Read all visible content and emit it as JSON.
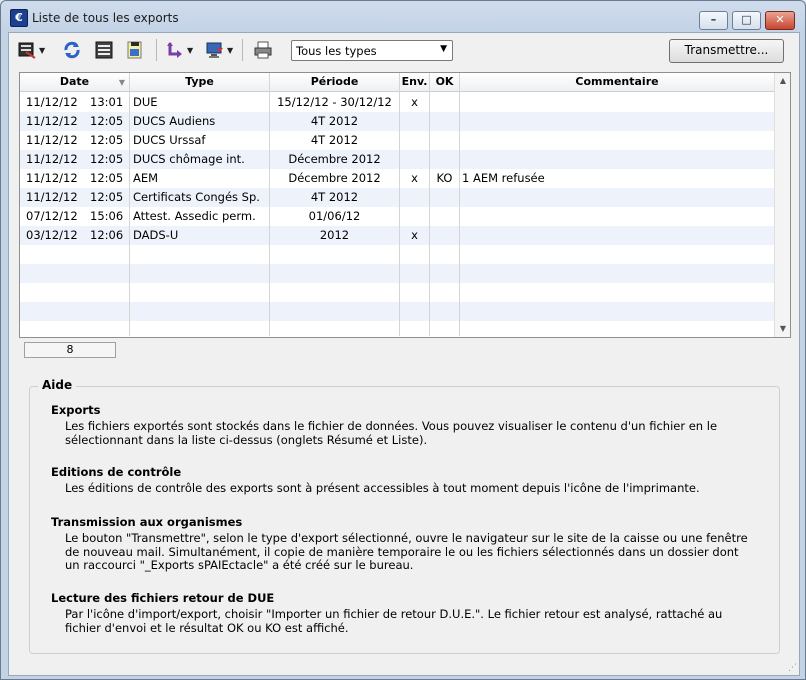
{
  "window": {
    "title": "Liste de tous les exports",
    "app_icon_letter": "€"
  },
  "toolbar": {
    "icons": [
      "export-list-icon",
      "refresh-icon",
      "records-icon",
      "edit-document-icon",
      "import-export-icon",
      "monitor-icon",
      "printer-icon"
    ],
    "type_select": "Tous les types",
    "transmit_label": "Transmettre..."
  },
  "grid": {
    "headers": [
      "Date",
      "Type",
      "Période",
      "Env.",
      "OK",
      "Commentaire"
    ],
    "rows": [
      {
        "date": "11/12/12",
        "time": "13:01",
        "type": "DUE",
        "period": "15/12/12 - 30/12/12",
        "env": "x",
        "ok": "",
        "comment": ""
      },
      {
        "date": "11/12/12",
        "time": "12:05",
        "type": "DUCS Audiens",
        "period": "4T 2012",
        "env": "",
        "ok": "",
        "comment": ""
      },
      {
        "date": "11/12/12",
        "time": "12:05",
        "type": "DUCS Urssaf",
        "period": "4T 2012",
        "env": "",
        "ok": "",
        "comment": ""
      },
      {
        "date": "11/12/12",
        "time": "12:05",
        "type": "DUCS chômage int.",
        "period": "Décembre 2012",
        "env": "",
        "ok": "",
        "comment": ""
      },
      {
        "date": "11/12/12",
        "time": "12:05",
        "type": "AEM",
        "period": "Décembre 2012",
        "env": "x",
        "ok": "KO",
        "comment": "1 AEM refusée"
      },
      {
        "date": "11/12/12",
        "time": "12:05",
        "type": "Certificats Congés Sp.",
        "period": "4T 2012",
        "env": "",
        "ok": "",
        "comment": ""
      },
      {
        "date": "07/12/12",
        "time": "15:06",
        "type": "Attest. Assedic perm.",
        "period": "01/06/12",
        "env": "",
        "ok": "",
        "comment": ""
      },
      {
        "date": "03/12/12",
        "time": "12:06",
        "type": "DADS-U",
        "period": "2012",
        "env": "x",
        "ok": "",
        "comment": ""
      }
    ],
    "count": "8"
  },
  "help": {
    "title": "Aide",
    "sections": [
      {
        "title": "Exports",
        "text": "Les fichiers exportés sont stockés dans le fichier de données. Vous pouvez visualiser le contenu d'un fichier en le sélectionnant dans la liste ci-dessus (onglets Résumé et Liste)."
      },
      {
        "title": "Editions de contrôle",
        "text": "Les éditions de contrôle des exports sont à présent accessibles à tout moment depuis l'icône de l'imprimante."
      },
      {
        "title": "Transmission aux organismes",
        "text": "Le bouton \"Transmettre\", selon le type d'export sélectionné, ouvre le navigateur sur le site de la caisse ou une fenêtre de nouveau mail. Simultanément, il copie de manière temporaire le ou les fichiers sélectionnés dans un dossier dont un raccourci \"_Exports sPAIEctacle\" a été créé sur le bureau."
      },
      {
        "title": "Lecture des fichiers retour de DUE",
        "text": "Par l'icône d'import/export, choisir \"Importer un fichier de retour D.U.E.\". Le fichier retour est analysé, rattaché au fichier d'envoi et le résultat OK ou KO est affiché."
      }
    ]
  }
}
